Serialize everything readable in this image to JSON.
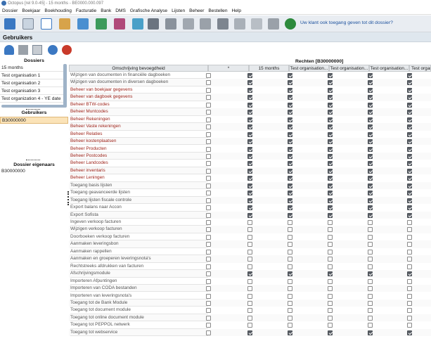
{
  "window": {
    "title": "Octopus [rel 9.0-45] - 15 months - BE0000.000.097"
  },
  "menu": {
    "items": [
      "Dossier",
      "Boekjaar",
      "Boekhouding",
      "Facturatie",
      "Bank",
      "DMS",
      "Grafische Analyse",
      "Lijsten",
      "Beheer",
      "Bestellen",
      "Help"
    ]
  },
  "toolbar": {
    "help_link": "Uw klant ook toegang geven tot dit dossier?"
  },
  "section": {
    "title": "Gebruikers"
  },
  "dossiers": {
    "title": "Dossiers",
    "items": [
      "15 months",
      "Test organisation 1",
      "Test organisation 2",
      "Test organisation 3",
      "Test organization 4 - YE date"
    ]
  },
  "gebruikers": {
    "title": "Gebruikers",
    "selected": "B30000000"
  },
  "eigenaars": {
    "title": "Dossier eigenaars",
    "value": "B30000000"
  },
  "rights": {
    "title": "Rechten [B30000000]",
    "columns": [
      "Omschrijving bevoegdheid",
      "*",
      "15 months",
      "Test organisation...",
      "Test organisation...",
      "Test organisation...",
      "Test organization..."
    ],
    "rows": [
      {
        "label": "Wijzigen van documenten in financiële dagboeken",
        "color": "gray",
        "checks": [
          0,
          1,
          1,
          1,
          1,
          1
        ]
      },
      {
        "label": "Wijzigen van documenten in diversen dagboeken",
        "color": "gray",
        "checks": [
          0,
          1,
          1,
          1,
          1,
          1
        ]
      },
      {
        "label": "Beheer van boekjaar gegevens",
        "color": "red",
        "checks": [
          0,
          1,
          1,
          1,
          1,
          1
        ]
      },
      {
        "label": "Beheer van dagboek gegevens",
        "color": "red",
        "checks": [
          0,
          1,
          1,
          1,
          1,
          1
        ]
      },
      {
        "label": "Beheer BTW-codes",
        "color": "red",
        "checks": [
          0,
          1,
          1,
          1,
          1,
          1
        ]
      },
      {
        "label": "Beheer Muntcodes",
        "color": "red",
        "checks": [
          0,
          1,
          1,
          1,
          1,
          1
        ]
      },
      {
        "label": "Beheer Rekeningen",
        "color": "red",
        "checks": [
          0,
          1,
          1,
          1,
          1,
          1
        ]
      },
      {
        "label": "Beheer Vaste rekeningen",
        "color": "red",
        "checks": [
          0,
          1,
          1,
          1,
          1,
          1
        ]
      },
      {
        "label": "Beheer Relaties",
        "color": "red",
        "checks": [
          0,
          1,
          1,
          1,
          1,
          1
        ]
      },
      {
        "label": "Beheer kostenplaatsen",
        "color": "red",
        "checks": [
          0,
          1,
          1,
          1,
          1,
          1
        ]
      },
      {
        "label": "Beheer Producten",
        "color": "red",
        "checks": [
          0,
          1,
          1,
          1,
          1,
          1
        ]
      },
      {
        "label": "Beheer Postcodes",
        "color": "red",
        "checks": [
          0,
          1,
          1,
          1,
          1,
          1
        ]
      },
      {
        "label": "Beheer Landcodes",
        "color": "red",
        "checks": [
          0,
          1,
          1,
          1,
          1,
          1
        ]
      },
      {
        "label": "Beheer inventaris",
        "color": "red",
        "checks": [
          0,
          1,
          1,
          1,
          1,
          1
        ]
      },
      {
        "label": "Beheer Leningen",
        "color": "red",
        "checks": [
          0,
          1,
          1,
          1,
          1,
          1
        ]
      },
      {
        "label": "Toegang basis lijsten",
        "color": "gray",
        "checks": [
          0,
          1,
          1,
          1,
          1,
          1
        ]
      },
      {
        "label": "Toegang geavanceerde lijsten",
        "color": "gray",
        "checks": [
          0,
          1,
          1,
          1,
          1,
          1
        ]
      },
      {
        "label": "Toegang lijsten fiscale controle",
        "color": "gray",
        "checks": [
          0,
          1,
          1,
          1,
          1,
          1
        ]
      },
      {
        "label": "Export balans naar Accon",
        "color": "gray",
        "checks": [
          0,
          1,
          1,
          1,
          1,
          1
        ]
      },
      {
        "label": "Export Sofista",
        "color": "gray",
        "checks": [
          0,
          1,
          1,
          1,
          1,
          1
        ]
      },
      {
        "label": "Ingeven verkoop facturen",
        "color": "gray",
        "checks": [
          0,
          0,
          0,
          0,
          0,
          0
        ]
      },
      {
        "label": "Wijzigen verkoop facturen",
        "color": "gray",
        "checks": [
          0,
          0,
          0,
          0,
          0,
          0
        ]
      },
      {
        "label": "Doorboeken verkoop facturen",
        "color": "gray",
        "checks": [
          0,
          0,
          0,
          0,
          0,
          0
        ]
      },
      {
        "label": "Aanmaken leveringsbon",
        "color": "gray",
        "checks": [
          0,
          0,
          0,
          0,
          0,
          0
        ]
      },
      {
        "label": "Aanmaken rappellen",
        "color": "gray",
        "checks": [
          0,
          0,
          0,
          0,
          0,
          0
        ]
      },
      {
        "label": "Aanmaken en groeperen leveringsnota's",
        "color": "gray",
        "checks": [
          0,
          0,
          0,
          0,
          0,
          0
        ]
      },
      {
        "label": "Rechtstreeks afdrukken van facturen",
        "color": "gray",
        "checks": [
          0,
          0,
          0,
          0,
          0,
          0
        ]
      },
      {
        "label": "Afschrijvingsmodule",
        "color": "gray",
        "checks": [
          0,
          1,
          1,
          1,
          1,
          1
        ]
      },
      {
        "label": "Importeren Afpuntingen",
        "color": "gray",
        "checks": [
          0,
          0,
          0,
          0,
          0,
          0
        ]
      },
      {
        "label": "Importeren van CODA bestanden",
        "color": "gray",
        "checks": [
          0,
          0,
          0,
          0,
          0,
          0
        ]
      },
      {
        "label": "Importeren van leveringsnota's",
        "color": "gray",
        "checks": [
          0,
          0,
          0,
          0,
          0,
          0
        ]
      },
      {
        "label": "Toegang tot de Bank Module",
        "color": "gray",
        "checks": [
          0,
          0,
          0,
          0,
          0,
          0
        ]
      },
      {
        "label": "Toegang tot document module",
        "color": "gray",
        "checks": [
          0,
          0,
          0,
          0,
          0,
          0
        ]
      },
      {
        "label": "Toegang tot online document module",
        "color": "gray",
        "checks": [
          0,
          0,
          0,
          0,
          0,
          0
        ]
      },
      {
        "label": "Toegang tot PEPPOL netwerk",
        "color": "gray",
        "checks": [
          0,
          0,
          0,
          0,
          0,
          0
        ]
      },
      {
        "label": "Toegang tot webservice",
        "color": "gray",
        "checks": [
          0,
          1,
          1,
          1,
          1,
          1
        ]
      }
    ]
  },
  "icons": [
    "new-user-icon",
    "delete-icon",
    "open-icon",
    "copy-user-icon",
    "remove-user-icon"
  ],
  "colors": {
    "header_bg": "#dfe7ee",
    "toolbar_bg": "#e9edf2",
    "selected_bg": "#fbe3b8",
    "red_text": "#9c1f15",
    "link": "#1a4f9c"
  }
}
